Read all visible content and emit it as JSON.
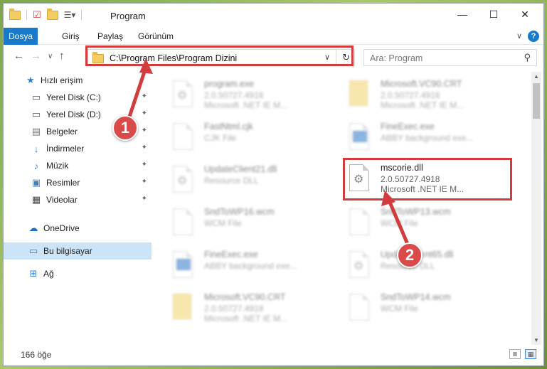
{
  "window": {
    "title": "Program",
    "controls": {
      "minimize": "—",
      "maximize": "☐",
      "close": "✕"
    }
  },
  "ribbon": {
    "tabs": [
      {
        "label": "Dosya",
        "active": true
      },
      {
        "label": "Giriş"
      },
      {
        "label": "Paylaş"
      },
      {
        "label": "Görünüm"
      }
    ],
    "help": "?"
  },
  "navbar": {
    "address": "C:\\Program Files\\Program Dizini",
    "search_placeholder": "Ara: Program"
  },
  "sidebar": {
    "items": [
      {
        "label": "Hızlı erişim",
        "icon": "star-icon",
        "pinned": false,
        "selected": false
      },
      {
        "label": "Yerel Disk (C:)",
        "icon": "drive-icon",
        "pinned": true,
        "selected": false
      },
      {
        "label": "Yerel Disk (D:)",
        "icon": "drive-icon",
        "pinned": true,
        "selected": false
      },
      {
        "label": "Belgeler",
        "icon": "document-icon",
        "pinned": true,
        "selected": false
      },
      {
        "label": "İndirmeler",
        "icon": "download-icon",
        "pinned": true,
        "selected": false
      },
      {
        "label": "Müzik",
        "icon": "music-icon",
        "pinned": true,
        "selected": false
      },
      {
        "label": "Resimler",
        "icon": "pictures-icon",
        "pinned": true,
        "selected": false
      },
      {
        "label": "Videolar",
        "icon": "video-icon",
        "pinned": true,
        "selected": false
      },
      {
        "label": "OneDrive",
        "icon": "cloud-icon",
        "pinned": false,
        "selected": false
      },
      {
        "label": "Bu bilgisayar",
        "icon": "computer-icon",
        "pinned": false,
        "selected": true
      },
      {
        "label": "Ağ",
        "icon": "network-icon",
        "pinned": false,
        "selected": false
      }
    ]
  },
  "files": [
    {
      "name": "program.exe",
      "line1": "2.0.50727.4918",
      "line2": "Microsoft .NET IE M...",
      "icon": "exe-icon",
      "blurred": true
    },
    {
      "name": "Microsoft.VC90.CRT",
      "line1": "2.0.50727.4918",
      "line2": "Microsoft .NET IE M...",
      "icon": "folder-file-icon",
      "blurred": true
    },
    {
      "name": "FastNtml.cjk",
      "line1": "CJK File",
      "line2": "",
      "icon": "file-icon",
      "blurred": true
    },
    {
      "name": "FineExec.exe",
      "line1": "ABBY background exe...",
      "line2": "",
      "icon": "app-icon",
      "blurred": true
    },
    {
      "name": "UpdateClient21.dll",
      "line1": "Resource DLL",
      "line2": "",
      "icon": "dll-icon",
      "blurred": true
    },
    {
      "name": "mscorie.dll",
      "line1": "2.0.50727.4918",
      "line2": "Microsoft .NET IE M...",
      "icon": "dll-icon",
      "blurred": false
    },
    {
      "name": "SndToWP16.wcm",
      "line1": "WCM File",
      "line2": "",
      "icon": "file-icon",
      "blurred": true
    },
    {
      "name": "SndToWP13.wcm",
      "line1": "WCM File",
      "line2": "",
      "icon": "file-icon",
      "blurred": true
    },
    {
      "name": "FineExec.exe",
      "line1": "ABBY background exe...",
      "line2": "",
      "icon": "app-icon",
      "blurred": true
    },
    {
      "name": "UpdateClient65.dll",
      "line1": "Resource DLL",
      "line2": "",
      "icon": "dll-icon",
      "blurred": true
    },
    {
      "name": "Microsoft.VC90.CRT",
      "line1": "2.0.50727.4918",
      "line2": "Microsoft .NET IE M...",
      "icon": "folder-file-icon",
      "blurred": true
    },
    {
      "name": "SndToWP14.wcm",
      "line1": "WCM File",
      "line2": "",
      "icon": "file-icon",
      "blurred": true
    }
  ],
  "status": {
    "count": "166 öğe"
  },
  "annotations": {
    "step1": "1",
    "step2": "2",
    "color": "#d33c3c"
  }
}
